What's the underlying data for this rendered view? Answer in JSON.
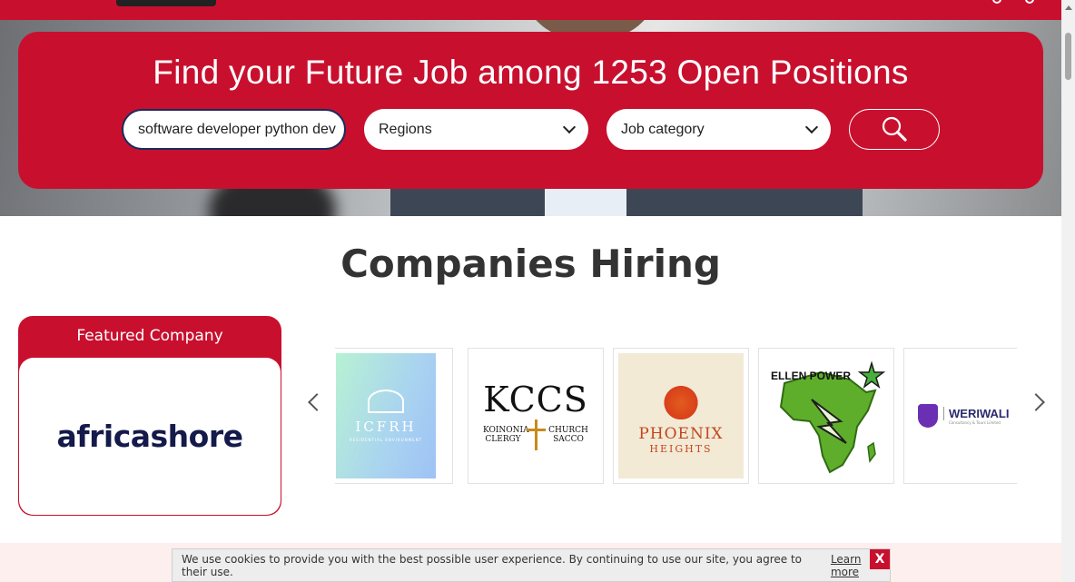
{
  "hero": {
    "title": "Find your Future Job among 1253 Open Positions",
    "keyword_value": "software developer python dev",
    "region_label": "Regions",
    "category_label": "Job category"
  },
  "companies": {
    "title": "Companies Hiring",
    "featured_label": "Featured Company",
    "featured_name": "africashore",
    "tiles": [
      {
        "name": "ICFRH",
        "tagline": "RESIDENTIAL ENVIRONMENT"
      },
      {
        "name": "KCCS",
        "left": "KOINONIA CLERGY",
        "right": "CHURCH SACCO"
      },
      {
        "name": "PHOENIX",
        "sub": "HEIGHTS"
      },
      {
        "name": "ELLEN POWER"
      },
      {
        "name": "WERIWALI",
        "sub": "Consultancy & Tours Limited"
      }
    ]
  },
  "cookie": {
    "text": "We use cookies to provide you with the best possible user experience. By continuing to use our site, you agree to their use.",
    "learn_more": "Learn more",
    "close_label": "X"
  },
  "colors": {
    "brand": "#c8102e",
    "navy": "#141a4a"
  }
}
